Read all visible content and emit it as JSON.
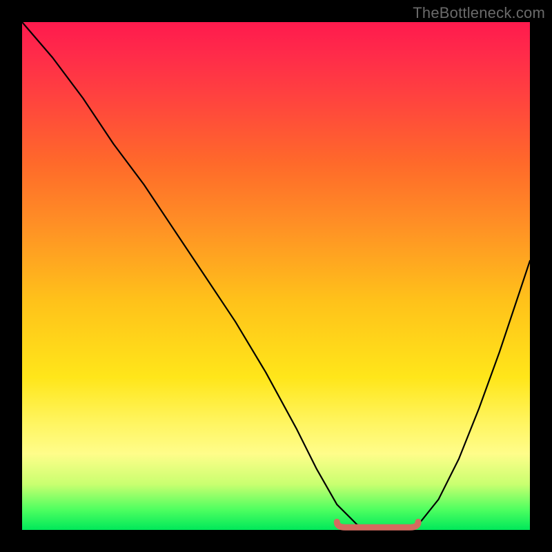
{
  "watermark": "TheBottleneck.com",
  "colors": {
    "frame": "#000000",
    "gradient_top": "#ff1a4d",
    "gradient_bottom": "#00e85a",
    "curve": "#000000",
    "bottom_marker": "#d46a5f"
  },
  "chart_data": {
    "type": "line",
    "title": "",
    "xlabel": "",
    "ylabel": "",
    "xlim": [
      0,
      100
    ],
    "ylim": [
      0,
      100
    ],
    "grid": false,
    "legend": false,
    "series": [
      {
        "name": "bottleneck-curve",
        "x": [
          0,
          6,
          12,
          18,
          24,
          30,
          36,
          42,
          48,
          54,
          58,
          62,
          66,
          70,
          74,
          78,
          82,
          86,
          90,
          94,
          98,
          100
        ],
        "y": [
          100,
          93,
          85,
          76,
          68,
          59,
          50,
          41,
          31,
          20,
          12,
          5,
          1,
          0,
          0,
          1,
          6,
          14,
          24,
          35,
          47,
          53
        ]
      }
    ],
    "annotations": [
      {
        "name": "optimal-region",
        "x_range": [
          62,
          78
        ],
        "y": 0.5
      }
    ]
  }
}
